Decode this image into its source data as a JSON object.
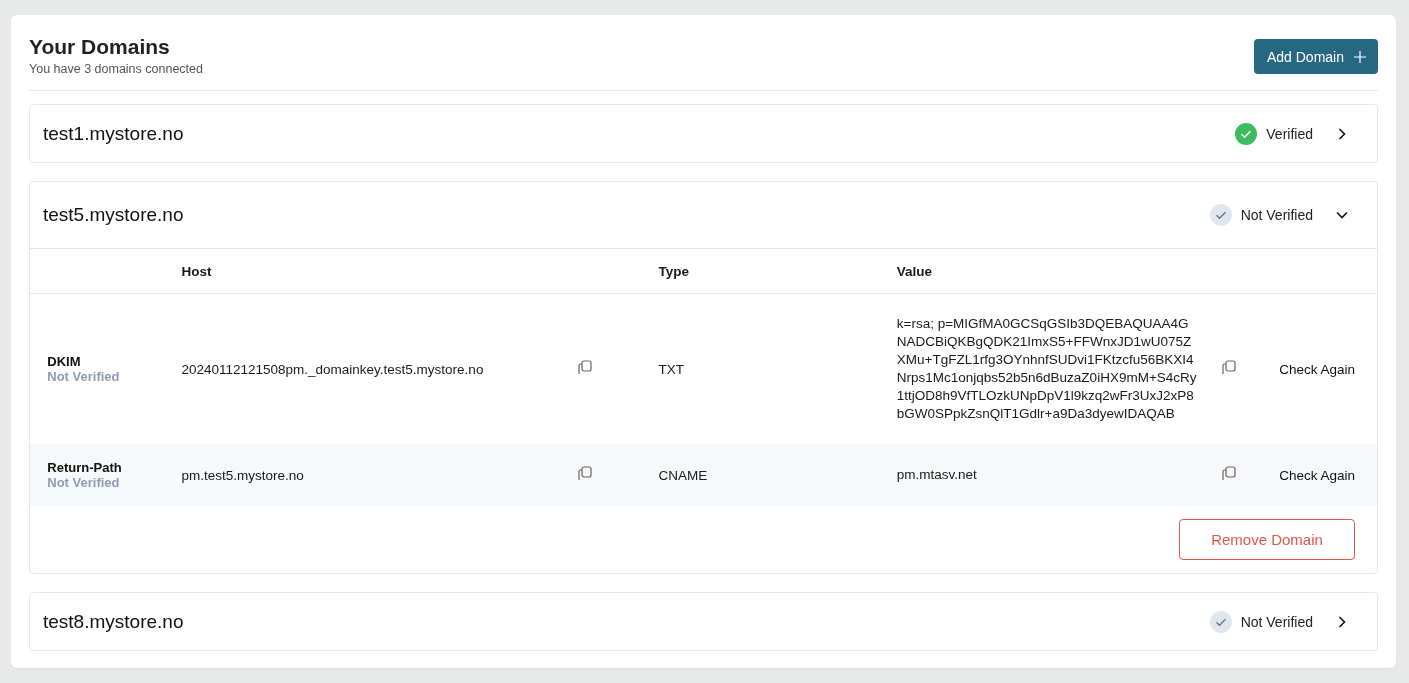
{
  "header": {
    "title": "Your Domains",
    "subtitle": "You have 3 domains connected",
    "add_button": "Add Domain"
  },
  "domains": [
    {
      "name": "test1.mystore.no",
      "verified": true,
      "status": "Verified",
      "expanded": false
    },
    {
      "name": "test5.mystore.no",
      "verified": false,
      "status": "Not Verified",
      "expanded": true,
      "columns": [
        "Host",
        "Type",
        "Value"
      ],
      "records": [
        {
          "name": "DKIM",
          "verified": false,
          "status": "Not Verified",
          "host": "20240112121508pm._domainkey.test5.mystore.no",
          "type": "TXT",
          "value": "k=rsa; p=MIGfMA0GCSqGSIb3DQEBAQUAA4GNADCBiQKBgQDK21ImxS5+FFWnxJD1wU075ZXMu+TgFZL1rfg3OYnhnfSUDvi1FKtzcfu56BKXI4Nrps1Mc1onjqbs52b5n6dBuzaZ0iHX9mM+S4cRy1ttjOD8h9VfTLOzkUNpDpV1l9kzq2wFr3UxJ2xP8bGW0SPpkZsnQlT1Gdlr+a9Da3dyewIDAQAB",
          "action": "Check Again"
        },
        {
          "name": "Return-Path",
          "verified": false,
          "status": "Not Verified",
          "host": "pm.test5.mystore.no",
          "type": "CNAME",
          "value": "pm.mtasv.net",
          "action": "Check Again"
        }
      ],
      "remove_button": "Remove Domain"
    },
    {
      "name": "test8.mystore.no",
      "verified": false,
      "status": "Not Verified",
      "expanded": false
    }
  ]
}
